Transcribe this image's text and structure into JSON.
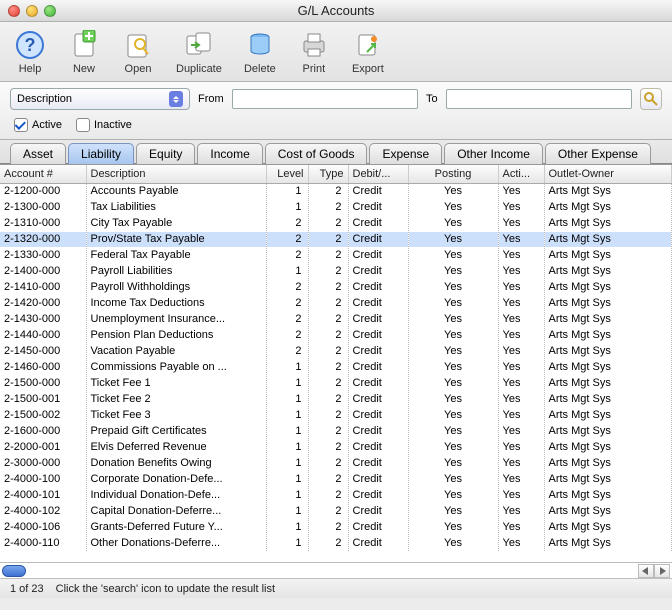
{
  "window": {
    "title": "G/L Accounts"
  },
  "toolbar": {
    "help": "Help",
    "new": "New",
    "open": "Open",
    "duplicate": "Duplicate",
    "delete": "Delete",
    "print": "Print",
    "export": "Export"
  },
  "filter": {
    "field_selected": "Description",
    "from_label": "From",
    "to_label": "To",
    "from_value": "",
    "to_value": "",
    "active_label": "Active",
    "inactive_label": "Inactive",
    "active_checked": true,
    "inactive_checked": false
  },
  "tabs": [
    "Asset",
    "Liability",
    "Equity",
    "Income",
    "Cost of Goods",
    "Expense",
    "Other Income",
    "Other Expense"
  ],
  "selected_tab": 1,
  "columns": {
    "account": "Account #",
    "description": "Description",
    "level": "Level",
    "type": "Type",
    "debit": "Debit/...",
    "posting": "Posting",
    "active": "Acti...",
    "outlet": "Outlet-Owner"
  },
  "selected_row_index": 3,
  "rows": [
    {
      "acct": "2-1200-000",
      "desc": "Accounts Payable",
      "level": 1,
      "type": 2,
      "dc": "Credit",
      "post": "Yes",
      "act": "Yes",
      "outlet": "Arts Mgt Sys"
    },
    {
      "acct": "2-1300-000",
      "desc": "Tax Liabilities",
      "level": 1,
      "type": 2,
      "dc": "Credit",
      "post": "Yes",
      "act": "Yes",
      "outlet": "Arts Mgt Sys"
    },
    {
      "acct": "2-1310-000",
      "desc": "City Tax Payable",
      "level": 2,
      "type": 2,
      "dc": "Credit",
      "post": "Yes",
      "act": "Yes",
      "outlet": "Arts Mgt Sys"
    },
    {
      "acct": "2-1320-000",
      "desc": "Prov/State Tax Payable",
      "level": 2,
      "type": 2,
      "dc": "Credit",
      "post": "Yes",
      "act": "Yes",
      "outlet": "Arts Mgt Sys"
    },
    {
      "acct": "2-1330-000",
      "desc": "Federal Tax Payable",
      "level": 2,
      "type": 2,
      "dc": "Credit",
      "post": "Yes",
      "act": "Yes",
      "outlet": "Arts Mgt Sys"
    },
    {
      "acct": "2-1400-000",
      "desc": "Payroll Liabilities",
      "level": 1,
      "type": 2,
      "dc": "Credit",
      "post": "Yes",
      "act": "Yes",
      "outlet": "Arts Mgt Sys"
    },
    {
      "acct": "2-1410-000",
      "desc": "Payroll Withholdings",
      "level": 2,
      "type": 2,
      "dc": "Credit",
      "post": "Yes",
      "act": "Yes",
      "outlet": "Arts Mgt Sys"
    },
    {
      "acct": "2-1420-000",
      "desc": "Income Tax Deductions",
      "level": 2,
      "type": 2,
      "dc": "Credit",
      "post": "Yes",
      "act": "Yes",
      "outlet": "Arts Mgt Sys"
    },
    {
      "acct": "2-1430-000",
      "desc": "Unemployment Insurance...",
      "level": 2,
      "type": 2,
      "dc": "Credit",
      "post": "Yes",
      "act": "Yes",
      "outlet": "Arts Mgt Sys"
    },
    {
      "acct": "2-1440-000",
      "desc": "Pension Plan Deductions",
      "level": 2,
      "type": 2,
      "dc": "Credit",
      "post": "Yes",
      "act": "Yes",
      "outlet": "Arts Mgt Sys"
    },
    {
      "acct": "2-1450-000",
      "desc": "Vacation Payable",
      "level": 2,
      "type": 2,
      "dc": "Credit",
      "post": "Yes",
      "act": "Yes",
      "outlet": "Arts Mgt Sys"
    },
    {
      "acct": "2-1460-000",
      "desc": "Commissions Payable on ...",
      "level": 1,
      "type": 2,
      "dc": "Credit",
      "post": "Yes",
      "act": "Yes",
      "outlet": "Arts Mgt Sys"
    },
    {
      "acct": "2-1500-000",
      "desc": "Ticket Fee 1",
      "level": 1,
      "type": 2,
      "dc": "Credit",
      "post": "Yes",
      "act": "Yes",
      "outlet": "Arts Mgt Sys"
    },
    {
      "acct": "2-1500-001",
      "desc": "Ticket Fee 2",
      "level": 1,
      "type": 2,
      "dc": "Credit",
      "post": "Yes",
      "act": "Yes",
      "outlet": "Arts Mgt Sys"
    },
    {
      "acct": "2-1500-002",
      "desc": "Ticket Fee 3",
      "level": 1,
      "type": 2,
      "dc": "Credit",
      "post": "Yes",
      "act": "Yes",
      "outlet": "Arts Mgt Sys"
    },
    {
      "acct": "2-1600-000",
      "desc": "Prepaid Gift Certificates",
      "level": 1,
      "type": 2,
      "dc": "Credit",
      "post": "Yes",
      "act": "Yes",
      "outlet": "Arts Mgt Sys"
    },
    {
      "acct": "2-2000-001",
      "desc": "Elvis Deferred Revenue",
      "level": 1,
      "type": 2,
      "dc": "Credit",
      "post": "Yes",
      "act": "Yes",
      "outlet": "Arts Mgt Sys"
    },
    {
      "acct": "2-3000-000",
      "desc": "Donation Benefits Owing",
      "level": 1,
      "type": 2,
      "dc": "Credit",
      "post": "Yes",
      "act": "Yes",
      "outlet": "Arts Mgt Sys"
    },
    {
      "acct": "2-4000-100",
      "desc": "Corporate Donation-Defe...",
      "level": 1,
      "type": 2,
      "dc": "Credit",
      "post": "Yes",
      "act": "Yes",
      "outlet": "Arts Mgt Sys"
    },
    {
      "acct": "2-4000-101",
      "desc": "Individual Donation-Defe...",
      "level": 1,
      "type": 2,
      "dc": "Credit",
      "post": "Yes",
      "act": "Yes",
      "outlet": "Arts Mgt Sys"
    },
    {
      "acct": "2-4000-102",
      "desc": "Capital Donation-Deferre...",
      "level": 1,
      "type": 2,
      "dc": "Credit",
      "post": "Yes",
      "act": "Yes",
      "outlet": "Arts Mgt Sys"
    },
    {
      "acct": "2-4000-106",
      "desc": "Grants-Deferred Future Y...",
      "level": 1,
      "type": 2,
      "dc": "Credit",
      "post": "Yes",
      "act": "Yes",
      "outlet": "Arts Mgt Sys"
    },
    {
      "acct": "2-4000-110",
      "desc": "Other Donations-Deferre...",
      "level": 1,
      "type": 2,
      "dc": "Credit",
      "post": "Yes",
      "act": "Yes",
      "outlet": "Arts Mgt Sys"
    }
  ],
  "status": {
    "count": "1 of 23",
    "hint": "Click the 'search' icon to update the result list"
  }
}
